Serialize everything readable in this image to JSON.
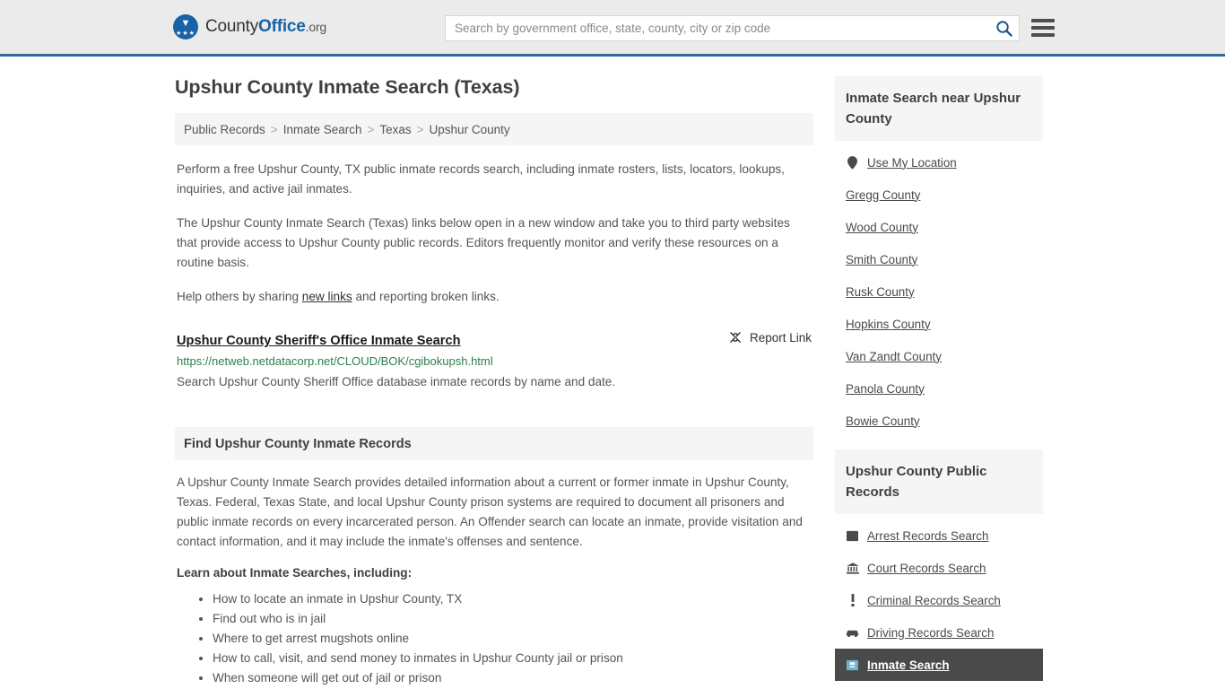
{
  "header": {
    "logo": {
      "part1": "County",
      "part2": "Office",
      "part3": ".org"
    },
    "search": {
      "placeholder": "Search by government office, state, county, city or zip code",
      "value": ""
    },
    "accent_color": "#336699",
    "background_color": "#ebebeb"
  },
  "page": {
    "title": "Upshur County Inmate Search (Texas)",
    "breadcrumb": [
      {
        "label": "Public Records"
      },
      {
        "label": "Inmate Search"
      },
      {
        "label": "Texas"
      },
      {
        "label": "Upshur County"
      }
    ],
    "breadcrumb_separator": ">",
    "intro_paragraphs": [
      "Perform a free Upshur County, TX public inmate records search, including inmate rosters, lists, locators, lookups, inquiries, and active jail inmates.",
      "The Upshur County Inmate Search (Texas) links below open in a new window and take you to third party websites that provide access to Upshur County public records. Editors frequently monitor and verify these resources on a routine basis."
    ],
    "help_text_before": "Help others by sharing ",
    "help_link": "new links",
    "help_text_after": " and reporting broken links."
  },
  "result": {
    "title": "Upshur County Sheriff's Office Inmate Search",
    "report_label": "Report Link",
    "report_icon": "broken-link-icon",
    "url": "https://netweb.netdatacorp.net/CLOUD/BOK/cgibokupsh.html",
    "url_color": "#2e7d4f",
    "description": "Search Upshur County Sheriff Office database inmate records by name and date."
  },
  "find_panel": {
    "heading": "Find Upshur County Inmate Records",
    "paragraph": "A Upshur County Inmate Search provides detailed information about a current or former inmate in Upshur County, Texas. Federal, Texas State, and local Upshur County prison systems are required to document all prisoners and public inmate records on every incarcerated person. An Offender search can locate an inmate, provide visitation and contact information, and it may include the inmate's offenses and sentence.",
    "learn_heading": "Learn about Inmate Searches, including:",
    "bullets": [
      "How to locate an inmate in Upshur County, TX",
      "Find out who is in jail",
      "Where to get arrest mugshots online",
      "How to call, visit, and send money to inmates in Upshur County jail or prison",
      "When someone will get out of jail or prison"
    ]
  },
  "sidebar": {
    "near_panel": {
      "heading": "Inmate Search near Upshur County",
      "items": [
        {
          "label": "Use My Location",
          "icon": "map-pin-icon"
        },
        {
          "label": "Gregg County",
          "icon": ""
        },
        {
          "label": "Wood County",
          "icon": ""
        },
        {
          "label": "Smith County",
          "icon": ""
        },
        {
          "label": "Rusk County",
          "icon": ""
        },
        {
          "label": "Hopkins County",
          "icon": ""
        },
        {
          "label": "Van Zandt County",
          "icon": ""
        },
        {
          "label": "Panola County",
          "icon": ""
        },
        {
          "label": "Bowie County",
          "icon": ""
        }
      ]
    },
    "records_panel": {
      "heading": "Upshur County Public Records",
      "items": [
        {
          "label": "Arrest Records Search",
          "icon": "fingerprint-card-icon",
          "active": false
        },
        {
          "label": "Court Records Search",
          "icon": "courthouse-icon",
          "active": false
        },
        {
          "label": "Criminal Records Search",
          "icon": "exclamation-icon",
          "active": false
        },
        {
          "label": "Driving Records Search",
          "icon": "car-icon",
          "active": false
        },
        {
          "label": "Inmate Search",
          "icon": "inmate-badge-icon",
          "active": true
        }
      ],
      "active_background": "#4a4a4a"
    }
  }
}
